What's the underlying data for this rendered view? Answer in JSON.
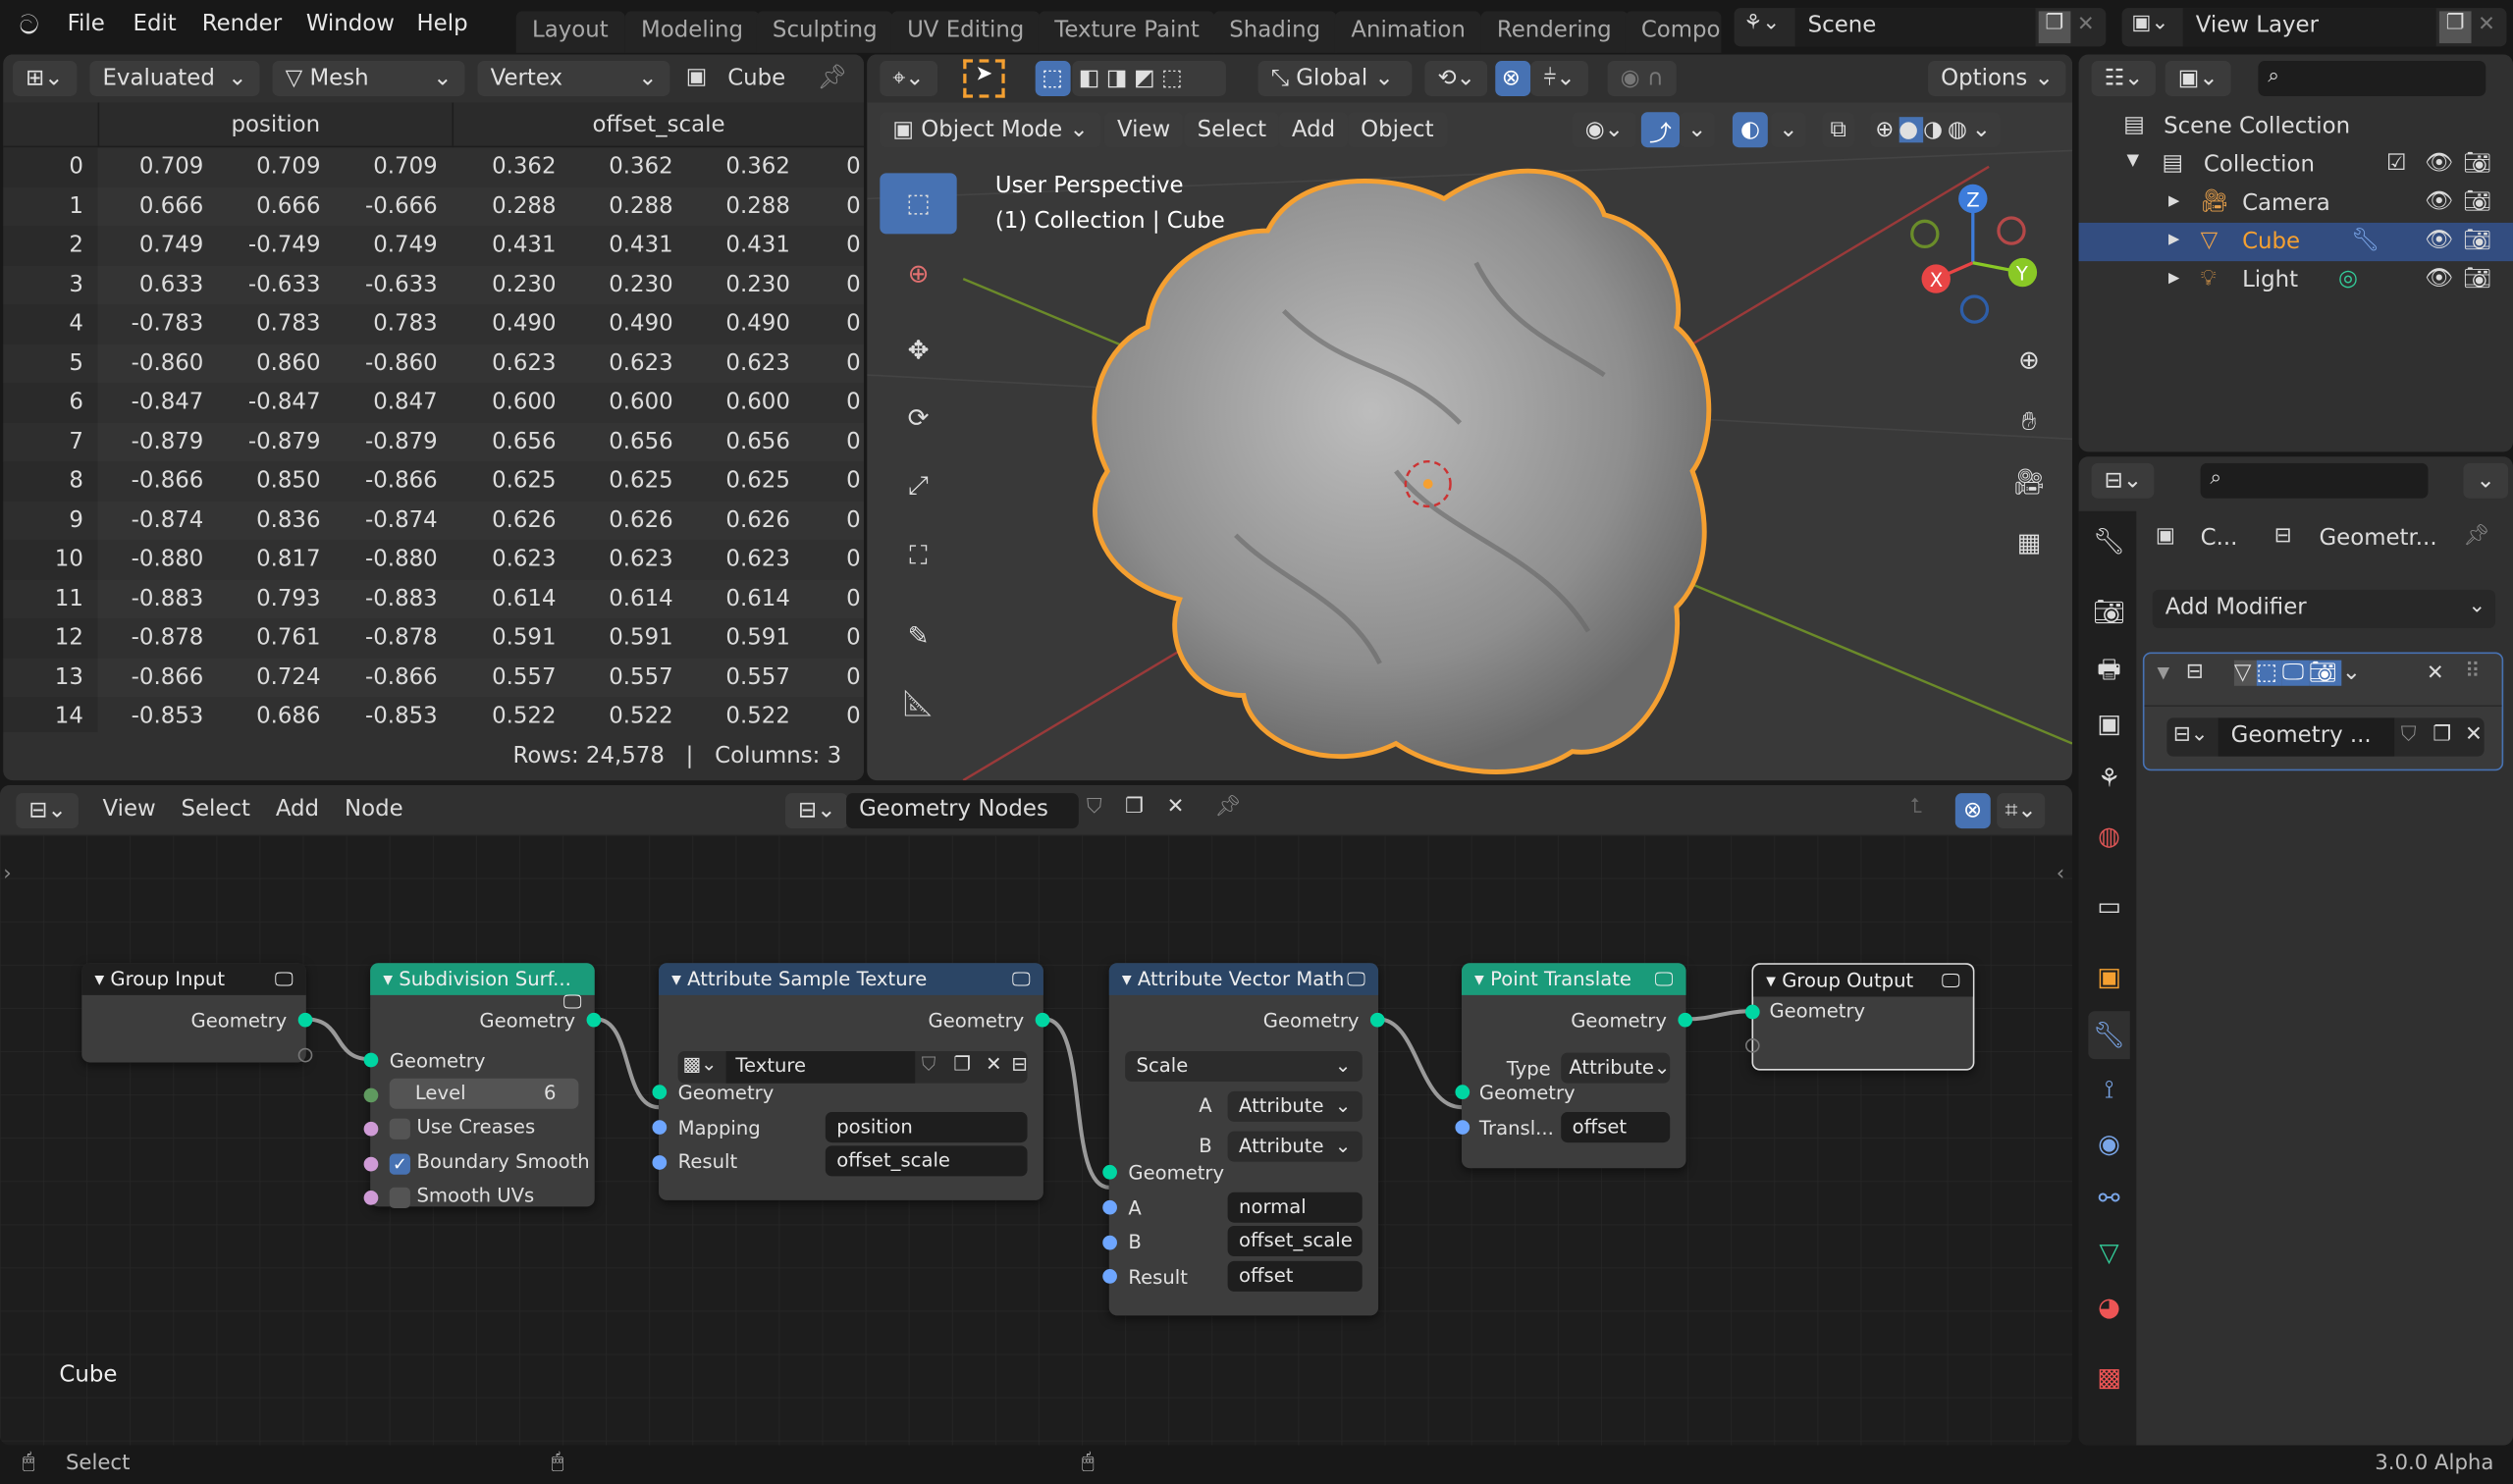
{
  "menu": [
    "File",
    "Edit",
    "Render",
    "Window",
    "Help"
  ],
  "workspaces": [
    "Layout",
    "Modeling",
    "Sculpting",
    "UV Editing",
    "Texture Paint",
    "Shading",
    "Animation",
    "Rendering",
    "Compo"
  ],
  "scene": "Scene",
  "view_layer": "View Layer",
  "spreadsheet": {
    "mode": "Evaluated",
    "data_type": "Mesh",
    "domain": "Vertex",
    "object": "Cube",
    "columns": [
      "position",
      "offset_scale"
    ],
    "rows": [
      [
        "0",
        "0.709",
        "0.709",
        "0.709",
        "0.362",
        "0.362",
        "0.362",
        "0"
      ],
      [
        "1",
        "0.666",
        "0.666",
        "-0.666",
        "0.288",
        "0.288",
        "0.288",
        "0"
      ],
      [
        "2",
        "0.749",
        "-0.749",
        "0.749",
        "0.431",
        "0.431",
        "0.431",
        "0"
      ],
      [
        "3",
        "0.633",
        "-0.633",
        "-0.633",
        "0.230",
        "0.230",
        "0.230",
        "0"
      ],
      [
        "4",
        "-0.783",
        "0.783",
        "0.783",
        "0.490",
        "0.490",
        "0.490",
        "0"
      ],
      [
        "5",
        "-0.860",
        "0.860",
        "-0.860",
        "0.623",
        "0.623",
        "0.623",
        "0"
      ],
      [
        "6",
        "-0.847",
        "-0.847",
        "0.847",
        "0.600",
        "0.600",
        "0.600",
        "0"
      ],
      [
        "7",
        "-0.879",
        "-0.879",
        "-0.879",
        "0.656",
        "0.656",
        "0.656",
        "0"
      ],
      [
        "8",
        "-0.866",
        "0.850",
        "-0.866",
        "0.625",
        "0.625",
        "0.625",
        "0"
      ],
      [
        "9",
        "-0.874",
        "0.836",
        "-0.874",
        "0.626",
        "0.626",
        "0.626",
        "0"
      ],
      [
        "10",
        "-0.880",
        "0.817",
        "-0.880",
        "0.623",
        "0.623",
        "0.623",
        "0"
      ],
      [
        "11",
        "-0.883",
        "0.793",
        "-0.883",
        "0.614",
        "0.614",
        "0.614",
        "0"
      ],
      [
        "12",
        "-0.878",
        "0.761",
        "-0.878",
        "0.591",
        "0.591",
        "0.591",
        "0"
      ],
      [
        "13",
        "-0.866",
        "0.724",
        "-0.866",
        "0.557",
        "0.557",
        "0.557",
        "0"
      ],
      [
        "14",
        "-0.853",
        "0.686",
        "-0.853",
        "0.522",
        "0.522",
        "0.522",
        "0"
      ]
    ],
    "footer": "Rows: 24,578   |   Columns: 3"
  },
  "viewport": {
    "orientation": "Global",
    "options": "Options",
    "mode": "Object Mode",
    "menus": [
      "View",
      "Select",
      "Add",
      "Object"
    ],
    "overlay_title": "User Perspective",
    "overlay_sub": "(1) Collection | Cube",
    "axes": {
      "x": "X",
      "y": "Y",
      "z": "Z"
    }
  },
  "outliner": {
    "root": "Scene Collection",
    "items": [
      "Collection",
      "Camera",
      "Cube",
      "Light"
    ]
  },
  "properties": {
    "breadcrumb_obj": "C...",
    "breadcrumb_mod": "Geometr...",
    "add_modifier": "Add Modifier",
    "node_group": "Geometry ..."
  },
  "node_editor": {
    "menus": [
      "View",
      "Select",
      "Add",
      "Node"
    ],
    "tree": "Geometry Nodes",
    "object_label": "Cube",
    "nodes": {
      "group_input": {
        "title": "Group Input",
        "out": "Geometry"
      },
      "subdiv": {
        "title": "Subdivision Surf...",
        "out": "Geometry",
        "in": "Geometry",
        "level_label": "Level",
        "level": "6",
        "use_creases": "Use Creases",
        "boundary_smooth": "Boundary Smooth",
        "smooth_uvs": "Smooth UVs"
      },
      "sample_tex": {
        "title": "Attribute Sample Texture",
        "out": "Geometry",
        "texture": "Texture",
        "in": "Geometry",
        "mapping_label": "Mapping",
        "mapping": "position",
        "result_label": "Result",
        "result": "offset_scale"
      },
      "vec_math": {
        "title": "Attribute Vector Math",
        "out": "Geometry",
        "op": "Scale",
        "a_label": "A",
        "a_type": "Attribute",
        "b_label": "B",
        "b_type": "Attribute",
        "in": "Geometry",
        "a": "normal",
        "b": "offset_scale",
        "result_label": "Result",
        "result": "offset"
      },
      "translate": {
        "title": "Point Translate",
        "out": "Geometry",
        "type_label": "Type",
        "type": "Attribute",
        "in": "Geometry",
        "transl_label": "Transl...",
        "transl": "offset"
      },
      "group_output": {
        "title": "Group Output",
        "in": "Geometry"
      }
    }
  },
  "status": {
    "left": "Select",
    "version": "3.0.0 Alpha"
  }
}
